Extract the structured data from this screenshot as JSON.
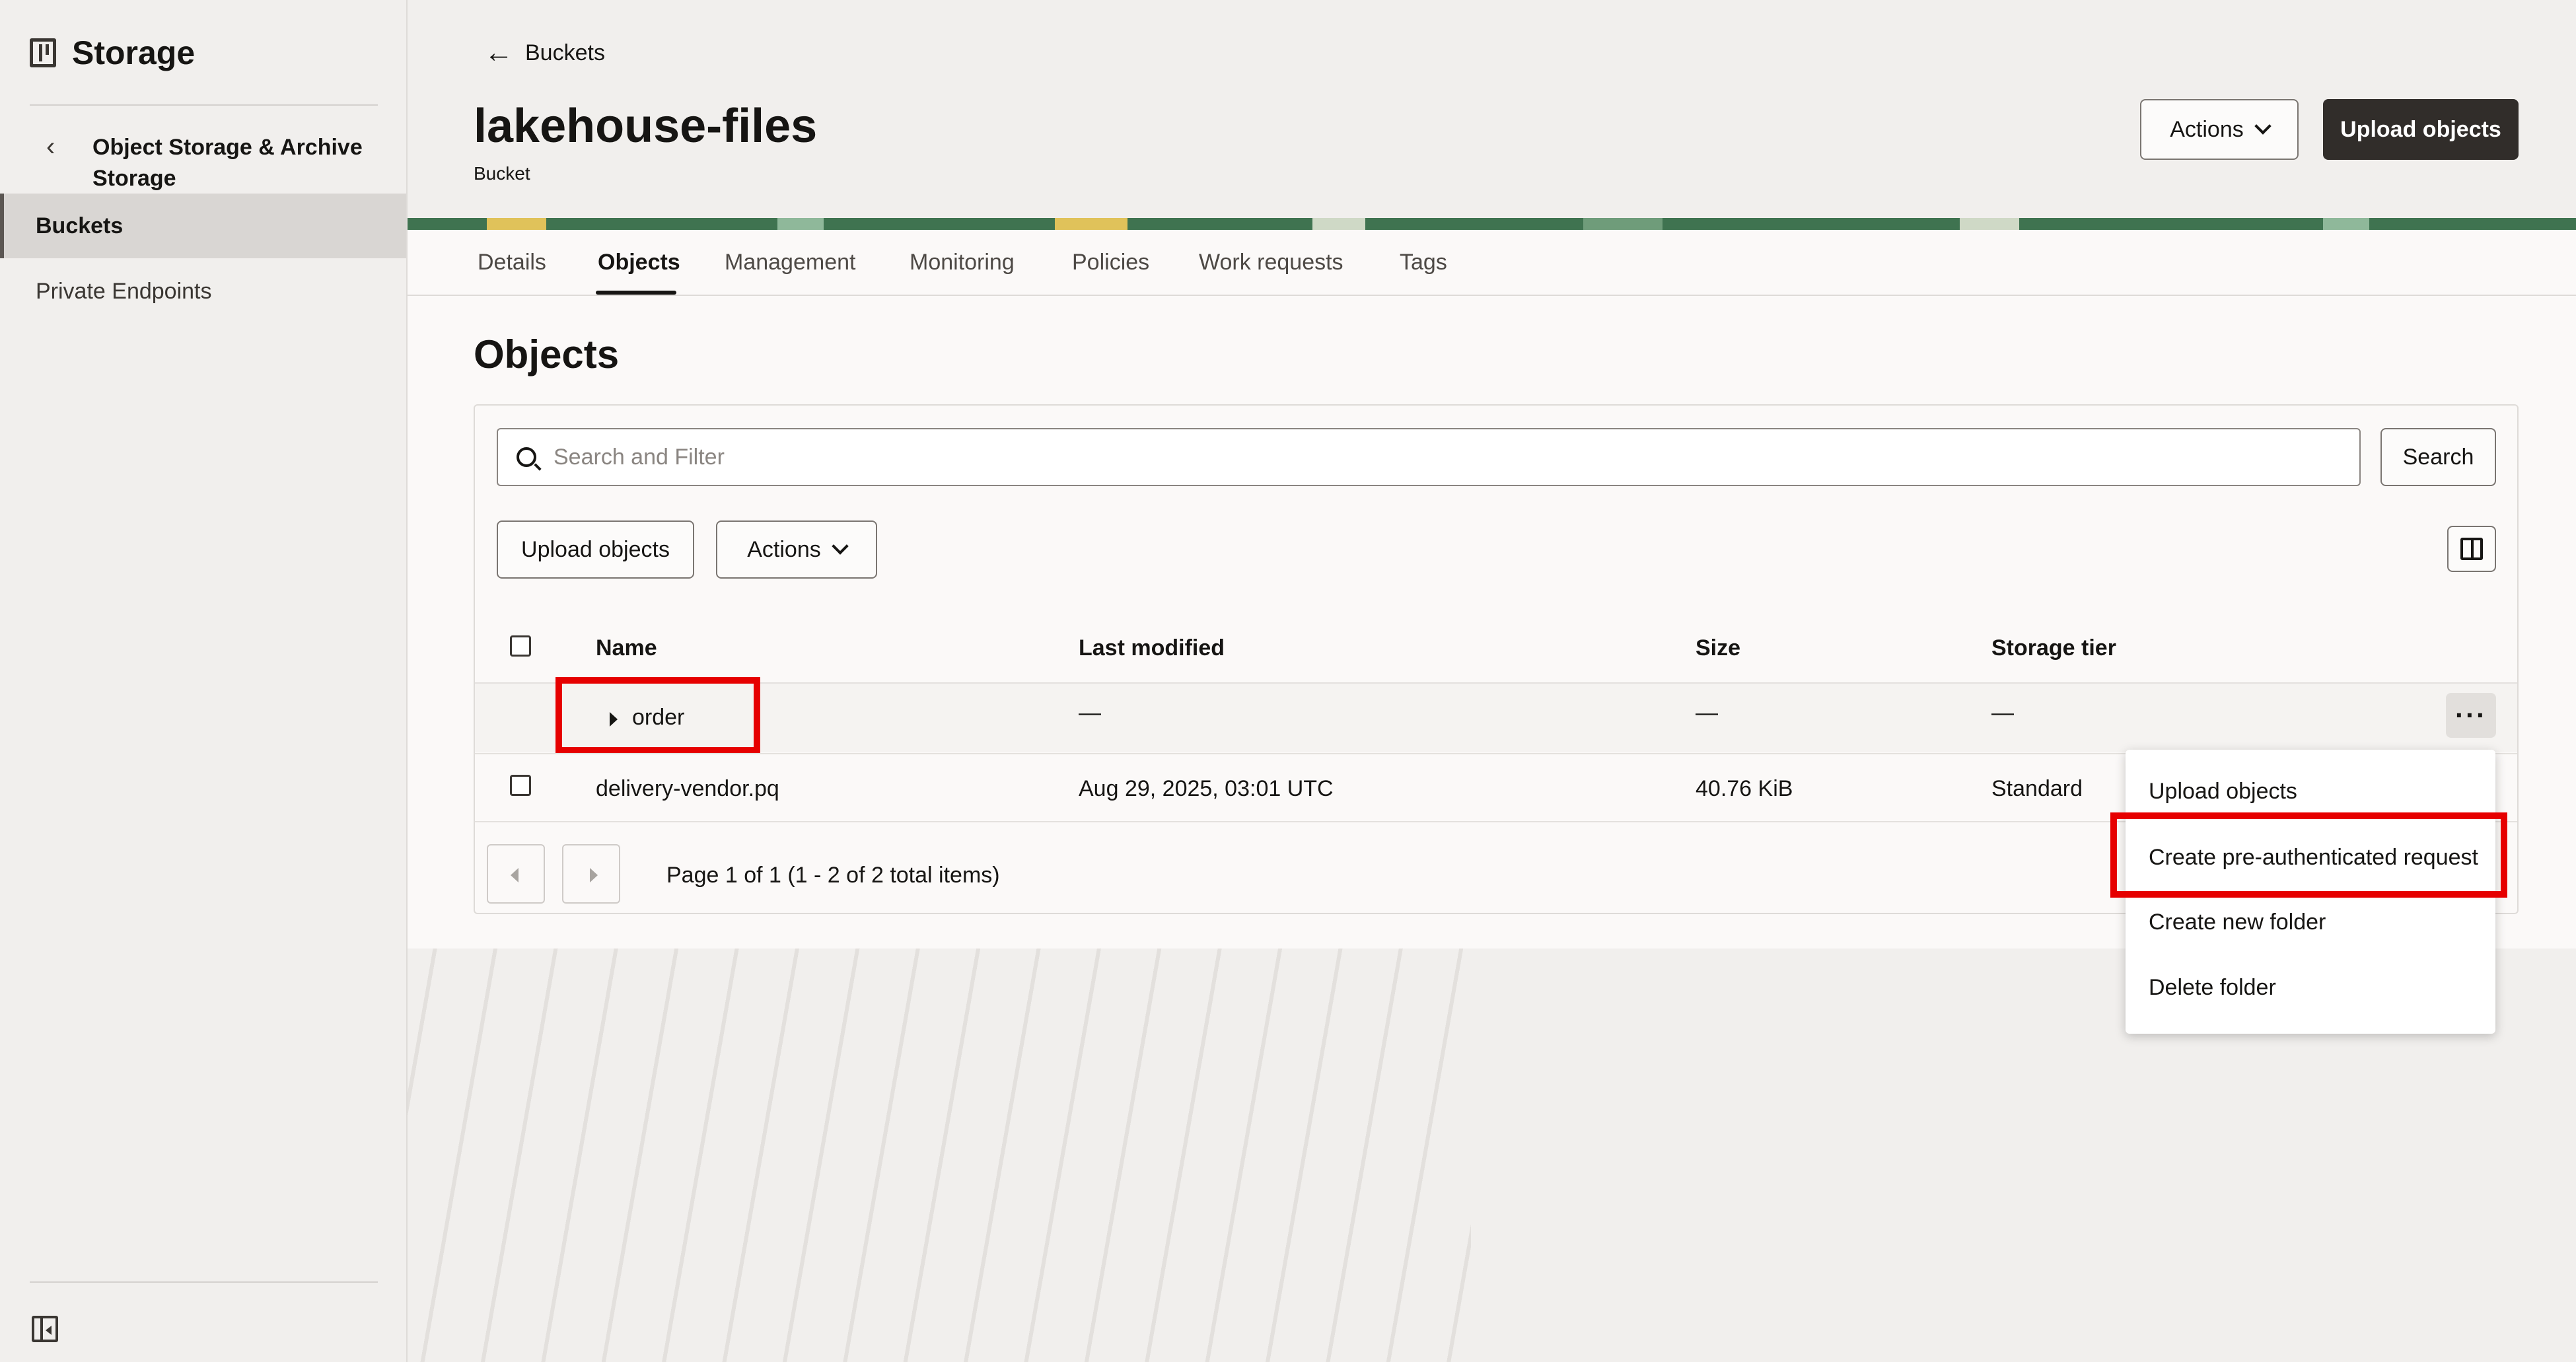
{
  "sidebar": {
    "title": "Storage",
    "section": "Object Storage & Archive Storage",
    "items": [
      {
        "label": "Buckets",
        "active": true
      },
      {
        "label": "Private Endpoints",
        "active": false
      }
    ]
  },
  "header": {
    "back_label": "Buckets",
    "title": "lakehouse-files",
    "subtitle": "Bucket",
    "actions_label": "Actions",
    "upload_label": "Upload objects"
  },
  "tabs": [
    {
      "label": "Details",
      "active": false
    },
    {
      "label": "Objects",
      "active": true
    },
    {
      "label": "Management",
      "active": false
    },
    {
      "label": "Monitoring",
      "active": false
    },
    {
      "label": "Policies",
      "active": false
    },
    {
      "label": "Work requests",
      "active": false
    },
    {
      "label": "Tags",
      "active": false
    }
  ],
  "objects": {
    "title": "Objects",
    "search_placeholder": "Search and Filter",
    "search_button": "Search",
    "upload_button": "Upload objects",
    "actions_button": "Actions",
    "columns": [
      "Name",
      "Last modified",
      "Size",
      "Storage tier"
    ],
    "rows": [
      {
        "name": "order",
        "last_modified": "—",
        "size": "—",
        "tier": "—",
        "is_folder": true
      },
      {
        "name": "delivery-vendor.pq",
        "last_modified": "Aug 29, 2025, 03:01 UTC",
        "size": "40.76 KiB",
        "tier": "Standard",
        "is_folder": false
      }
    ],
    "pagination": "Page 1 of 1 (1 - 2 of 2 total items)"
  },
  "context_menu": {
    "items": [
      "Upload objects",
      "Create pre-authenticated request",
      "Create new folder",
      "Delete folder"
    ],
    "highlighted": "Create pre-authenticated request"
  },
  "colors": {
    "primary_button": "#312d2a",
    "highlight": "#e60000",
    "active_nav": "#d9d6d3",
    "banner": "#3f7350"
  }
}
